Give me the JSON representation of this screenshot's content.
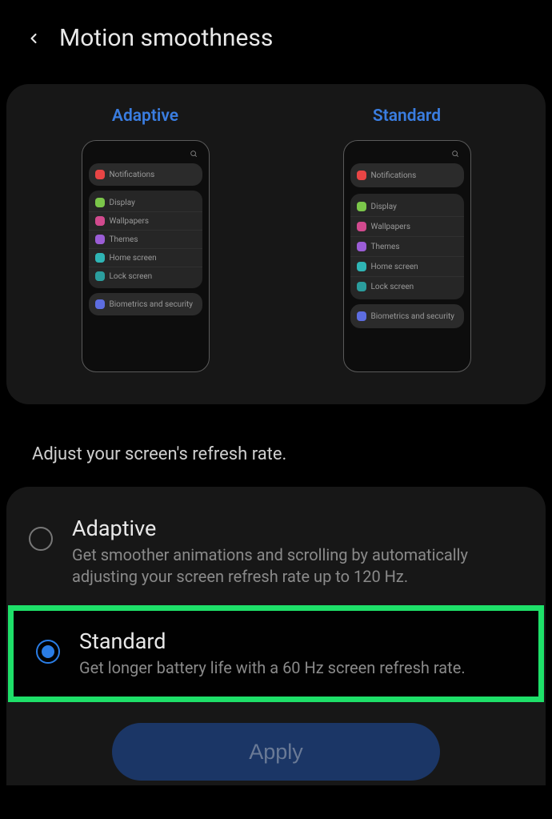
{
  "header": {
    "title": "Motion smoothness"
  },
  "preview": {
    "adaptive_label": "Adaptive",
    "standard_label": "Standard",
    "mock_items": {
      "notifications": "Notifications",
      "display": "Display",
      "wallpapers": "Wallpapers",
      "themes": "Themes",
      "home_screen": "Home screen",
      "lock_screen": "Lock screen",
      "biometrics": "Biometrics and security"
    }
  },
  "description": "Adjust your screen's refresh rate.",
  "options": {
    "adaptive": {
      "title": "Adaptive",
      "desc": "Get smoother animations and scrolling by automatically adjusting your screen refresh rate up to 120 Hz.",
      "selected": false
    },
    "standard": {
      "title": "Standard",
      "desc": "Get longer battery life with a 60 Hz screen refresh rate.",
      "selected": true
    }
  },
  "apply_label": "Apply"
}
